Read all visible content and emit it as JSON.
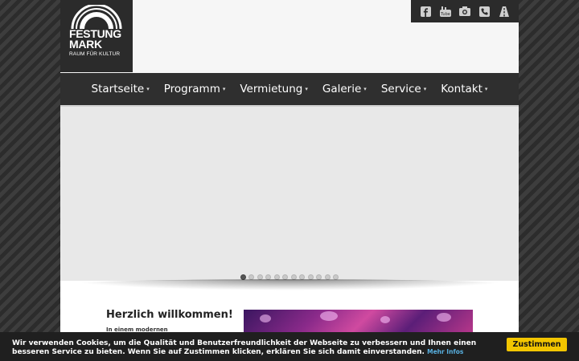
{
  "logo": {
    "line1": "FESTUNG",
    "line2": "MARK",
    "tagline": "RAUM FÜR KULTUR"
  },
  "social": [
    "facebook-icon",
    "youtube-icon",
    "camera-icon",
    "phone-icon",
    "route-icon"
  ],
  "nav": {
    "items": [
      {
        "label": "Startseite"
      },
      {
        "label": "Programm"
      },
      {
        "label": "Vermietung"
      },
      {
        "label": "Galerie"
      },
      {
        "label": "Service"
      },
      {
        "label": "Kontakt"
      }
    ],
    "caret": "▾"
  },
  "slider": {
    "dot_count": 12,
    "active_index": 0
  },
  "welcome": {
    "title": "Herzlich willkommen!",
    "subtitle": "In einem modernen"
  },
  "cookie": {
    "text": "Wir verwenden Cookies, um die Qualität und Benutzerfreundlichkeit der Webseite zu verbessern und Ihnen einen besseren Service zu bieten. Wenn Sie auf Zustimmen klicken, erklären Sie sich damit einverstanden.",
    "more_label": "Mehr Infos",
    "accept_label": "Zustimmen"
  },
  "colors": {
    "accent": "#f2c500",
    "nav_bg": "#2f2f2f",
    "link": "#58b0e0"
  }
}
